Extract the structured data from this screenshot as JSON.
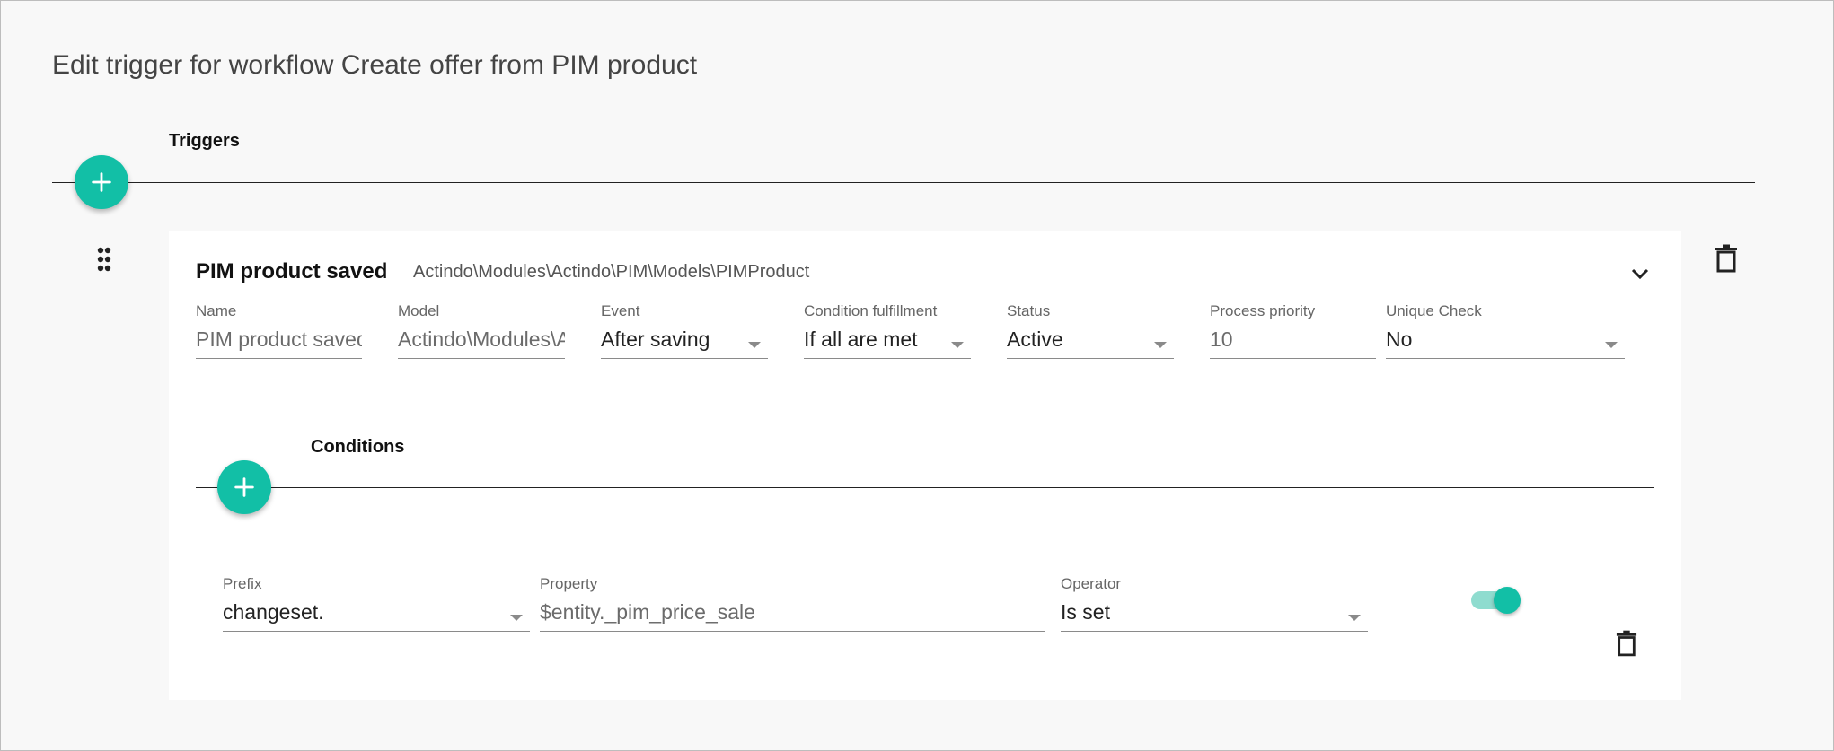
{
  "page": {
    "title": "Edit trigger for workflow Create offer from PIM product"
  },
  "triggers_section": {
    "label": "Triggers",
    "add_icon": "plus-icon"
  },
  "trigger": {
    "title": "PIM product saved",
    "model_path": "Actindo\\Modules\\Actindo\\PIM\\Models\\PIMProduct",
    "drag_icon": "drag-handle-icon",
    "expand_icon": "chevron-down-icon",
    "delete_icon": "trash-icon",
    "fields": {
      "name": {
        "label": "Name",
        "value": "PIM product saved"
      },
      "model": {
        "label": "Model",
        "value": "Actindo\\Modules\\Actindo\\PIM\\Models\\PIMProduct"
      },
      "event": {
        "label": "Event",
        "value": "After saving"
      },
      "condition_fulfillment": {
        "label": "Condition fulfillment",
        "value": "If all are met"
      },
      "status": {
        "label": "Status",
        "value": "Active"
      },
      "process_priority": {
        "label": "Process priority",
        "value": "10"
      },
      "unique_check": {
        "label": "Unique Check",
        "value": "No"
      }
    }
  },
  "conditions_section": {
    "label": "Conditions",
    "add_icon": "plus-icon"
  },
  "condition": {
    "prefix": {
      "label": "Prefix",
      "value": "changeset."
    },
    "property": {
      "label": "Property",
      "value": "$entity._pim_price_sale"
    },
    "operator": {
      "label": "Operator",
      "value": "Is set"
    },
    "enabled": true,
    "delete_icon": "trash-icon"
  },
  "colors": {
    "accent": "#12bfa6",
    "accent_light": "#8fdccf",
    "background": "#f8f8f8",
    "card": "#ffffff"
  }
}
